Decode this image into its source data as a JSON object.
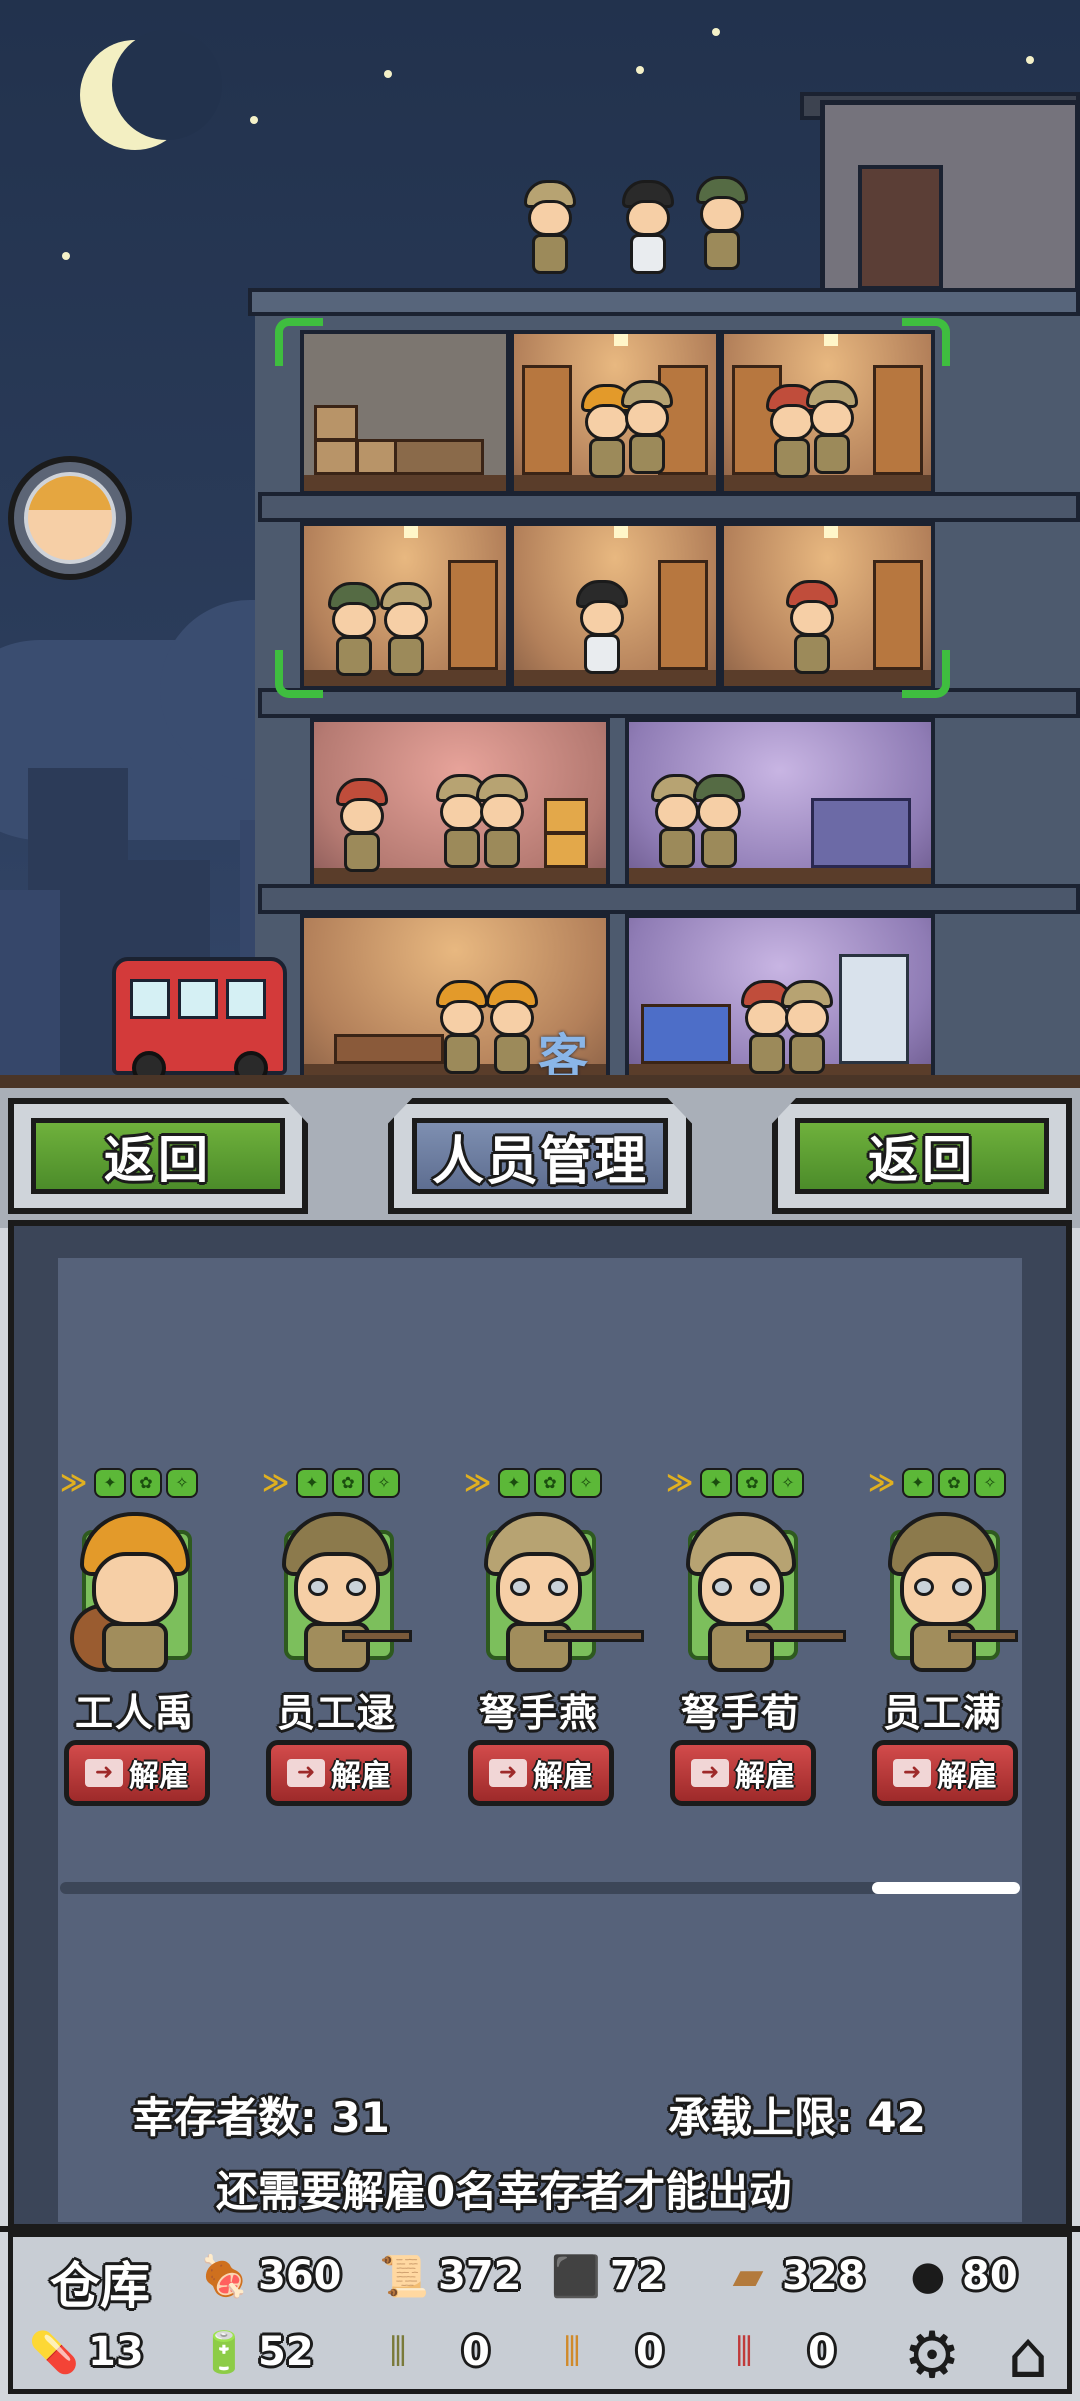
{
  "scene": {
    "visitor_label": "客"
  },
  "tabs": {
    "left_back": "返回",
    "title": "人员管理",
    "right_back": "返回"
  },
  "roster": {
    "fire_label": "解雇",
    "workers": [
      {
        "name": "工人禹",
        "role": "worker",
        "hat_color": "#e39a2a"
      },
      {
        "name": "员工逯",
        "role": "staff",
        "hat_color": "#8c7a4c"
      },
      {
        "name": "弩手燕",
        "role": "crossbow",
        "hat_color": "#b7a372"
      },
      {
        "name": "弩手荀",
        "role": "crossbow",
        "hat_color": "#b7a372"
      },
      {
        "name": "员工满",
        "role": "staff",
        "hat_color": "#8c7a4c"
      }
    ],
    "scroll_position": 1.0
  },
  "stats": {
    "survivors": "幸存者数: 31",
    "capacity": "承载上限: 42",
    "requirement": "还需要解雇0名幸存者才能出动"
  },
  "warehouse": {
    "title": "仓库",
    "resources": [
      {
        "icon": "meat-icon",
        "glyph": "🍖",
        "value": "360"
      },
      {
        "icon": "cloth-icon",
        "glyph": "📜",
        "value": "372"
      },
      {
        "icon": "iron-icon",
        "glyph": "⬜",
        "value": "72"
      },
      {
        "icon": "wood-icon",
        "glyph": "🪵",
        "value": "328"
      },
      {
        "icon": "oil-icon",
        "glyph": "💧",
        "value": "80"
      },
      {
        "icon": "pill-icon",
        "glyph": "💊",
        "value": "13"
      },
      {
        "icon": "battery-icon",
        "glyph": "🔋",
        "value": "52"
      },
      {
        "icon": "bullets-icon",
        "glyph": "▮",
        "value": "0"
      },
      {
        "icon": "rifle-ammo-icon",
        "glyph": "▮",
        "value": "0"
      },
      {
        "icon": "shotgun-shell-icon",
        "glyph": "▮",
        "value": "0"
      }
    ]
  },
  "colors": {
    "accent_green": "#5cb838",
    "fire_red": "#d24b4b",
    "panel_bg": "#56627a"
  }
}
